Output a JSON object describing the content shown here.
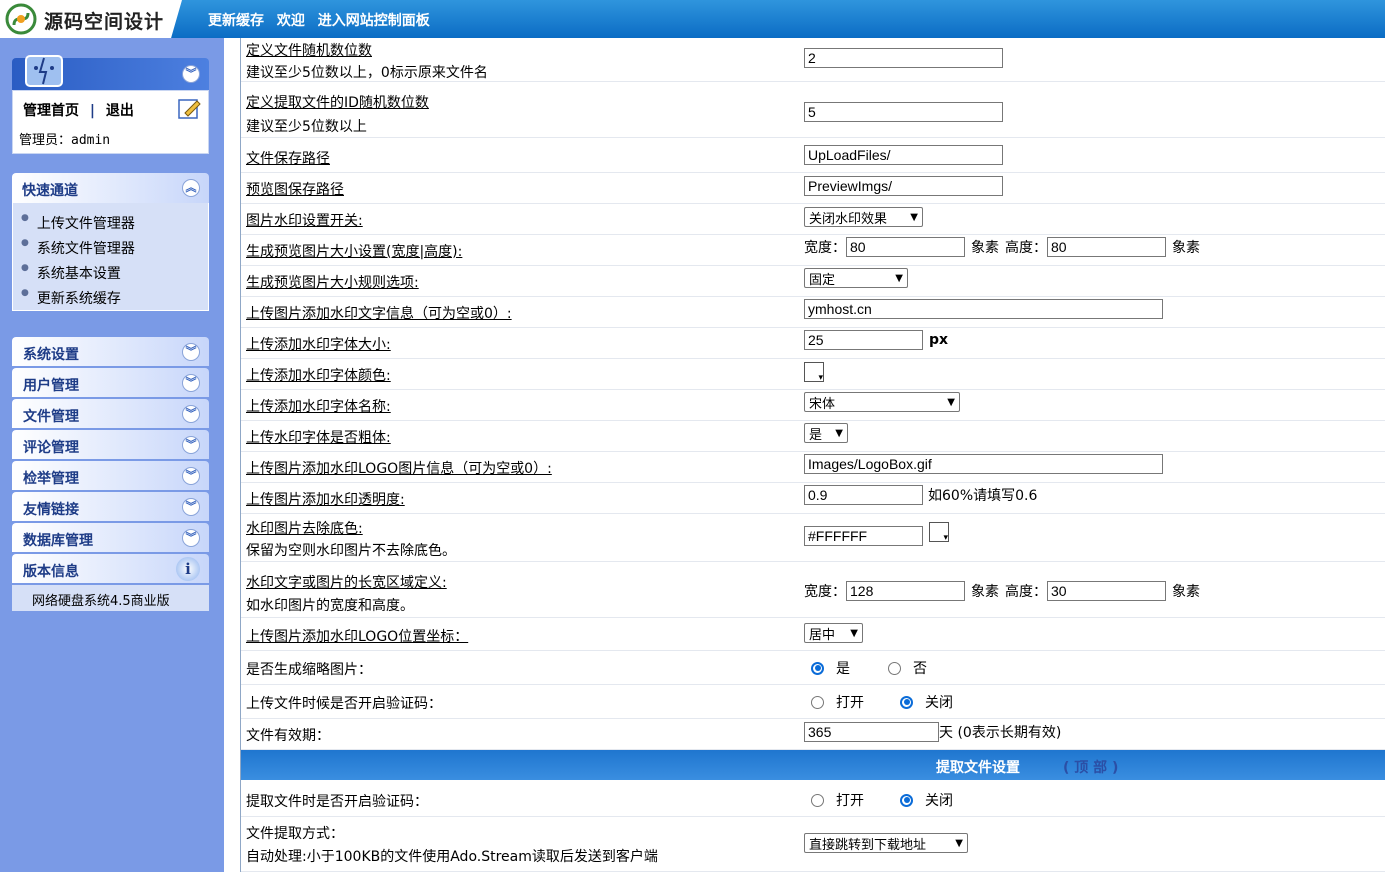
{
  "header": {
    "logo_text": "源码空间设计",
    "links": [
      "更新缓存",
      "欢迎",
      "进入网站控制面板"
    ]
  },
  "sidebar": {
    "admin": {
      "home": "管理首页",
      "sep": "|",
      "logout": "退出",
      "user": "管理员：admin"
    },
    "quick": {
      "title": "快速通道",
      "items": [
        "上传文件管理器",
        "系统文件管理器",
        "系统基本设置",
        "更新系统缓存"
      ]
    },
    "menus": [
      "系统设置",
      "用户管理",
      "文件管理",
      "评论管理",
      "检举管理",
      "友情链接",
      "数据库管理",
      "版本信息"
    ],
    "version": "网络硬盘系统4.5商业版"
  },
  "form": {
    "r1": {
      "label": "定义文件随机数位数",
      "hint": "建议至少5位数以上，0标示原来文件名",
      "value": "2"
    },
    "r2": {
      "label": "定义提取文件的ID随机数位数",
      "hint": "建议至少5位数以上",
      "value": "5"
    },
    "r3": {
      "label": "文件保存路径",
      "value": "UpLoadFiles/"
    },
    "r4": {
      "label": "预览图保存路径",
      "value": "PreviewImgs/"
    },
    "r5": {
      "label": "图片水印设置开关:",
      "value": "关闭水印效果"
    },
    "r6": {
      "label": "生成预览图片大小设置(宽度|高度):",
      "w_label": "宽度：",
      "w": "80",
      "unit": "象素",
      "h_label": "高度：",
      "h": "80"
    },
    "r7": {
      "label": "生成预览图片大小规则选项:",
      "value": "固定"
    },
    "r8": {
      "label": "上传图片添加水印文字信息（可为空或0）:",
      "value": "ymhost.cn"
    },
    "r9": {
      "label": "上传添加水印字体大小:",
      "value": "25",
      "unit": "px"
    },
    "r10": {
      "label": "上传添加水印字体颜色:"
    },
    "r11": {
      "label": "上传添加水印字体名称:",
      "value": "宋体"
    },
    "r12": {
      "label": "上传水印字体是否粗体:",
      "value": "是"
    },
    "r13": {
      "label": "上传图片添加水印LOGO图片信息（可为空或0）:",
      "value": "Images/LogoBox.gif"
    },
    "r14": {
      "label": "上传图片添加水印透明度:",
      "value": "0.9",
      "note": "如60%请填写0.6"
    },
    "r15": {
      "label": "水印图片去除底色:",
      "hint": "保留为空则水印图片不去除底色。",
      "value": "#FFFFFF"
    },
    "r16": {
      "label": "水印文字或图片的长宽区域定义:",
      "hint": "如水印图片的宽度和高度。",
      "w_label": "宽度：",
      "w": "128",
      "unit": "象素",
      "h_label": "高度：",
      "h": "30"
    },
    "r17": {
      "label": "上传图片添加水印LOGO位置坐标：",
      "value": "居中"
    },
    "r18": {
      "label": "是否生成缩略图片：",
      "opt1": "是",
      "opt2": "否"
    },
    "r19": {
      "label": "上传文件时候是否开启验证码：",
      "opt1": "打开",
      "opt2": "关闭"
    },
    "r20": {
      "label": "文件有效期：",
      "value": "365",
      "note": "天 (0表示长期有效)"
    }
  },
  "section": {
    "title": "提取文件设置",
    "top_link": "( 顶 部 )"
  },
  "form2": {
    "r1": {
      "label": "提取文件时是否开启验证码：",
      "opt1": "打开",
      "opt2": "关闭"
    },
    "r2": {
      "label": "文件提取方式：",
      "hint": "自动处理:小于100KB的文件使用Ado.Stream读取后发送到客户端",
      "value": "直接跳转到下载地址"
    }
  }
}
